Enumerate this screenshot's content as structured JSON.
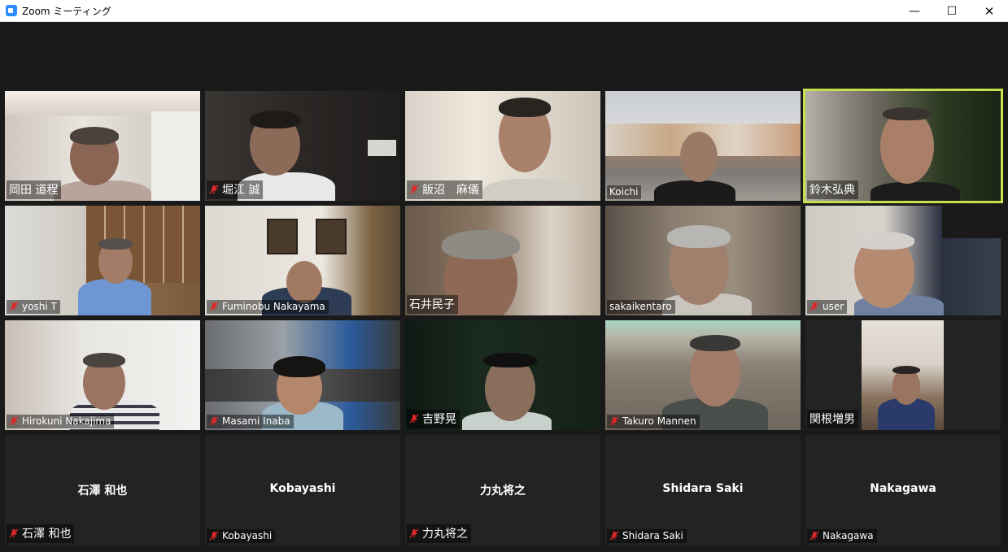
{
  "window": {
    "title": "Zoom ミーティング",
    "minimize": "—",
    "maximize": "☐",
    "close": "✕"
  },
  "participants": [
    {
      "name": "岡田 道程",
      "muted": false,
      "video": true
    },
    {
      "name": "堀江 誠",
      "muted": true,
      "video": true
    },
    {
      "name": "飯沼　麻儀",
      "muted": true,
      "video": true
    },
    {
      "name": "Koichi",
      "muted": false,
      "video": true
    },
    {
      "name": "鈴木弘典",
      "muted": false,
      "video": true,
      "active": true
    },
    {
      "name": "yoshi T",
      "muted": true,
      "video": true
    },
    {
      "name": "Fuminobu Nakayama",
      "muted": true,
      "video": true
    },
    {
      "name": "石井民子",
      "muted": false,
      "video": true
    },
    {
      "name": "sakaikentaro",
      "muted": false,
      "video": true
    },
    {
      "name": "user",
      "muted": true,
      "video": true
    },
    {
      "name": "Hirokuni Nakajima",
      "muted": true,
      "video": true
    },
    {
      "name": "Masami Inaba",
      "muted": true,
      "video": true
    },
    {
      "name": "吉野晃",
      "muted": true,
      "video": true
    },
    {
      "name": "Takuro Mannen",
      "muted": true,
      "video": true
    },
    {
      "name": "関根増男",
      "muted": false,
      "video": true
    },
    {
      "name": "石澤 和也",
      "muted": true,
      "video": false
    },
    {
      "name": "Kobayashi",
      "muted": true,
      "video": false
    },
    {
      "name": "力丸将之",
      "muted": true,
      "video": false
    },
    {
      "name": "Shidara Saki",
      "muted": true,
      "video": false
    },
    {
      "name": "Nakagawa",
      "muted": true,
      "video": false
    }
  ],
  "colors": {
    "active_border": "#c6e04b",
    "muted_icon": "#e02828",
    "background": "#1a1a1a",
    "tile_empty": "#232323"
  },
  "icons": {
    "app": "zoom-icon",
    "muted": "mic-muted-icon"
  }
}
